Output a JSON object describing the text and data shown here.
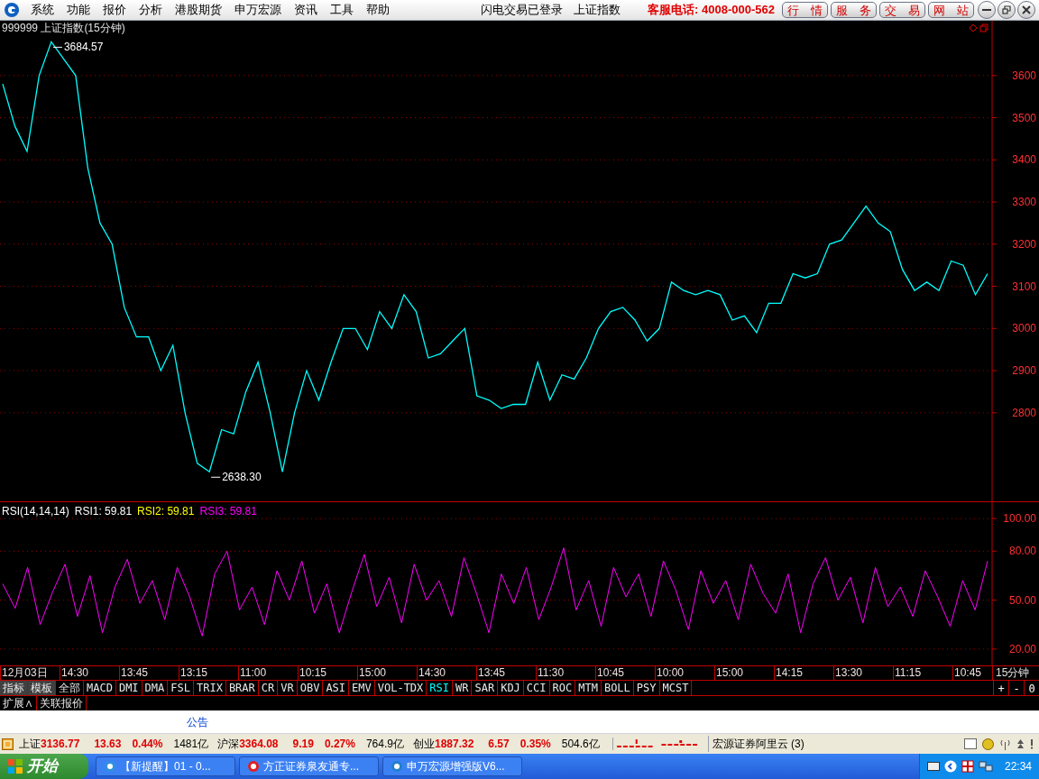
{
  "menu": {
    "items": [
      "系统",
      "功能",
      "报价",
      "分析",
      "港股期货",
      "申万宏源",
      "资讯",
      "工具",
      "帮助"
    ],
    "status": [
      "闪电交易已登录",
      "上证指数"
    ],
    "hotline": "客服电话: 4008-000-562",
    "buttons": [
      "行　情",
      "服　务",
      "交　易",
      "网　站"
    ]
  },
  "price_panel": {
    "title": "999999 上证指数(15分钟)",
    "chart_data": {
      "type": "line",
      "ylim": [
        2590,
        3730
      ],
      "yticks": [
        2800,
        2900,
        3000,
        3100,
        3200,
        3300,
        3400,
        3500,
        3600
      ],
      "series": [
        {
          "color": "#00ffff",
          "values": [
            3580,
            3480,
            3420,
            3600,
            3680,
            3640,
            3600,
            3380,
            3250,
            3200,
            3050,
            2980,
            2980,
            2900,
            2960,
            2800,
            2680,
            2660,
            2760,
            2750,
            2850,
            2920,
            2800,
            2660,
            2800,
            2900,
            2830,
            2920,
            3000,
            3000,
            2950,
            3040,
            3000,
            3080,
            3040,
            2930,
            2940,
            2970,
            3000,
            2840,
            2830,
            2810,
            2820,
            2820,
            2920,
            2830,
            2890,
            2880,
            2930,
            3000,
            3040,
            3050,
            3020,
            2970,
            3000,
            3110,
            3090,
            3080,
            3090,
            3080,
            3020,
            3030,
            2990,
            3060,
            3060,
            3130,
            3120,
            3130,
            3200,
            3210,
            3250,
            3290,
            3250,
            3230,
            3140,
            3090,
            3110,
            3090,
            3160,
            3150,
            3080,
            3130
          ]
        }
      ],
      "grid": true,
      "annotations": [
        {
          "text": "3684.57"
        },
        {
          "text": "2638.30"
        }
      ]
    }
  },
  "rsi_panel": {
    "legend": [
      {
        "text": "RSI(14,14,14)",
        "color": "#ffffff"
      },
      {
        "text": "RSI1: 59.81",
        "color": "#ffffff"
      },
      {
        "text": "RSI2: 59.81",
        "color": "#ffff00"
      },
      {
        "text": "RSI3: 59.81",
        "color": "#ff00ff"
      }
    ],
    "chart_data": {
      "type": "line",
      "ylim": [
        10,
        110
      ],
      "yticks": [
        {
          "value": 20,
          "label": "20.00"
        },
        {
          "value": 50,
          "label": "50.00"
        },
        {
          "value": 80,
          "label": "80.00"
        },
        {
          "value": 100,
          "label": "100.00"
        }
      ],
      "grid": true,
      "series": [
        {
          "color": "#ff00ff",
          "values": [
            60,
            45,
            70,
            35,
            55,
            72,
            40,
            65,
            30,
            58,
            75,
            48,
            62,
            38,
            70,
            52,
            28,
            66,
            80,
            44,
            58,
            35,
            68,
            50,
            74,
            42,
            60,
            30,
            55,
            78,
            46,
            64,
            36,
            72,
            50,
            62,
            40,
            76,
            54,
            30,
            66,
            48,
            70,
            38,
            58,
            82,
            44,
            62,
            34,
            70,
            52,
            66,
            40,
            74,
            56,
            32,
            68,
            48,
            62,
            38,
            72,
            54,
            42,
            66,
            30,
            60,
            76,
            50,
            64,
            36,
            70,
            46,
            58,
            40,
            68,
            52,
            34,
            62,
            44,
            74
          ]
        }
      ]
    }
  },
  "time_axis": {
    "labels": [
      "12月03日",
      "14:30",
      "13:45",
      "13:15",
      "11:00",
      "10:15",
      "15:00",
      "14:30",
      "13:45",
      "11:30",
      "10:45",
      "10:00",
      "15:00",
      "14:15",
      "13:30",
      "11:15",
      "10:45"
    ],
    "period": "15分钟"
  },
  "indicator_tabs": [
    {
      "label": "指标",
      "kind": "menu",
      "selected": false
    },
    {
      "label": "模板",
      "kind": "menu",
      "selected": false
    },
    {
      "label": "全部",
      "kind": "indicator",
      "selected": false
    },
    {
      "label": "MACD",
      "kind": "indicator",
      "selected": false
    },
    {
      "label": "DMI",
      "kind": "indicator",
      "selected": false
    },
    {
      "label": "DMA",
      "kind": "indicator",
      "selected": false
    },
    {
      "label": "FSL",
      "kind": "indicator",
      "selected": false
    },
    {
      "label": "TRIX",
      "kind": "indicator",
      "selected": false
    },
    {
      "label": "BRAR",
      "kind": "indicator",
      "selected": false
    },
    {
      "label": "CR",
      "kind": "indicator",
      "selected": false
    },
    {
      "label": "VR",
      "kind": "indicator",
      "selected": false
    },
    {
      "label": "OBV",
      "kind": "indicator",
      "selected": false
    },
    {
      "label": "ASI",
      "kind": "indicator",
      "selected": false
    },
    {
      "label": "EMV",
      "kind": "indicator",
      "selected": false
    },
    {
      "label": "VOL-TDX",
      "kind": "indicator",
      "selected": false
    },
    {
      "label": "RSI",
      "kind": "indicator",
      "selected": true
    },
    {
      "label": "WR",
      "kind": "indicator",
      "selected": false
    },
    {
      "label": "SAR",
      "kind": "indicator",
      "selected": false
    },
    {
      "label": "KDJ",
      "kind": "indicator",
      "selected": false
    },
    {
      "label": "CCI",
      "kind": "indicator",
      "selected": false
    },
    {
      "label": "ROC",
      "kind": "indicator",
      "selected": false
    },
    {
      "label": "MTM",
      "kind": "indicator",
      "selected": false
    },
    {
      "label": "BOLL",
      "kind": "indicator",
      "selected": false
    },
    {
      "label": "PSY",
      "kind": "indicator",
      "selected": false
    },
    {
      "label": "MCST",
      "kind": "indicator",
      "selected": false
    }
  ],
  "zoom_buttons": [
    "+",
    "-",
    "0"
  ],
  "extra_tabs": [
    "扩展∧",
    "关联报价"
  ],
  "notice": "公告",
  "status_bar": {
    "indices": [
      {
        "name": "上证",
        "price": "3136.77",
        "change": "13.63",
        "pct": "0.44%",
        "volume": "1481亿"
      },
      {
        "name": "沪深",
        "price": "3364.08",
        "change": "9.19",
        "pct": "0.27%",
        "volume": "764.9亿"
      },
      {
        "name": "创业",
        "price": "1887.32",
        "change": "6.57",
        "pct": "0.35%",
        "volume": "504.6亿"
      }
    ],
    "server": "宏源证券阿里云 (3)"
  },
  "taskbar": {
    "start": "开始",
    "tasks": [
      "【新提醒】01 - 0...",
      "方正证券泉友通专...",
      "申万宏源增强版V6..."
    ],
    "clock": "22:34"
  }
}
